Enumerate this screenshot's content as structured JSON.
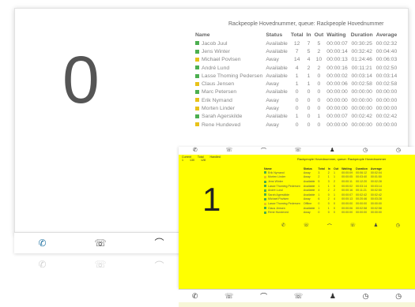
{
  "screen1": {
    "count": "0",
    "title": "Rackpeople Hovednummer, queue: Rackpeople Hovednummer",
    "columns": [
      "Name",
      "Status",
      "Total",
      "In",
      "Out",
      "Waiting",
      "Duration",
      "Average"
    ],
    "rows": [
      {
        "color": "#4caf50",
        "name": "Jacob Juul",
        "status": "Available",
        "total": "12",
        "in": "7",
        "out": "5",
        "waiting": "00:00:07",
        "duration": "00:30:25",
        "average": "00:02:32"
      },
      {
        "color": "#4caf50",
        "name": "Jens Winter",
        "status": "Available",
        "total": "7",
        "in": "5",
        "out": "2",
        "waiting": "00:00:14",
        "duration": "00:32:42",
        "average": "00:04:40"
      },
      {
        "color": "#e8c21a",
        "name": "Michael Povlsen",
        "status": "Away",
        "total": "14",
        "in": "4",
        "out": "10",
        "waiting": "00:00:13",
        "duration": "01:24:46",
        "average": "00:06:03"
      },
      {
        "color": "#4caf50",
        "name": "André Lund",
        "status": "Available",
        "total": "4",
        "in": "2",
        "out": "2",
        "waiting": "00:00:16",
        "duration": "00:11:21",
        "average": "00:02:50"
      },
      {
        "color": "#4caf50",
        "name": "Lasse Thoming Pedersen",
        "status": "Available",
        "total": "1",
        "in": "1",
        "out": "0",
        "waiting": "00:00:02",
        "duration": "00:03:14",
        "average": "00:03:14"
      },
      {
        "color": "#e8c21a",
        "name": "Claus Jensen",
        "status": "Away",
        "total": "1",
        "in": "1",
        "out": "0",
        "waiting": "00:00:06",
        "duration": "00:02:58",
        "average": "00:02:58"
      },
      {
        "color": "#4caf50",
        "name": "Marc Petersen",
        "status": "Available",
        "total": "0",
        "in": "0",
        "out": "0",
        "waiting": "00:00:00",
        "duration": "00:00:00",
        "average": "00:00:00"
      },
      {
        "color": "#e8c21a",
        "name": "Erik Nymand",
        "status": "Away",
        "total": "0",
        "in": "0",
        "out": "0",
        "waiting": "00:00:00",
        "duration": "00:00:00",
        "average": "00:00:00"
      },
      {
        "color": "#e8c21a",
        "name": "Morten Linder",
        "status": "Away",
        "total": "0",
        "in": "0",
        "out": "0",
        "waiting": "00:00:00",
        "duration": "00:00:00",
        "average": "00:00:00"
      },
      {
        "color": "#4caf50",
        "name": "Sarah Agerskilde",
        "status": "Available",
        "total": "1",
        "in": "0",
        "out": "1",
        "waiting": "00:00:07",
        "duration": "00:02:42",
        "average": "00:02:42"
      },
      {
        "color": "#e8c21a",
        "name": "Rene Hundeved",
        "status": "Away",
        "total": "0",
        "in": "0",
        "out": "0",
        "waiting": "00:00:00",
        "duration": "00:00:00",
        "average": "00:00:00"
      }
    ]
  },
  "screen2": {
    "count": "1",
    "title": "Rackpeople Hovednummer, queue: Rackpeople Hovednummer",
    "sub_labels": [
      "Current",
      "Total",
      "Handled"
    ],
    "sub_values": [
      "1",
      "130",
      "128"
    ],
    "columns": [
      "Name",
      "Status",
      "Total",
      "In",
      "Out",
      "Waiting",
      "Duration",
      "Average"
    ],
    "rows": [
      {
        "color": "#4caf50",
        "name": "Erik Nymand",
        "status": "Away",
        "total": "3",
        "in": "2",
        "out": "1",
        "waiting": "00:00:09",
        "duration": "00:06:12",
        "average": "00:02:04"
      },
      {
        "color": "#e8c21a",
        "name": "Morten Linder",
        "status": "Away",
        "total": "2",
        "in": "1",
        "out": "1",
        "waiting": "00:00:05",
        "duration": "00:03:40",
        "average": "00:01:50"
      },
      {
        "color": "#4caf50",
        "name": "Jens Winter",
        "status": "Available",
        "total": "5",
        "in": "3",
        "out": "2",
        "waiting": "00:00:11",
        "duration": "00:12:20",
        "average": "00:02:28"
      },
      {
        "color": "#4caf50",
        "name": "Lasse Thoming Pedersen",
        "status": "Available",
        "total": "1",
        "in": "1",
        "out": "0",
        "waiting": "00:00:02",
        "duration": "00:03:14",
        "average": "00:03:14"
      },
      {
        "color": "#4caf50",
        "name": "André Lund",
        "status": "Available",
        "total": "4",
        "in": "2",
        "out": "2",
        "waiting": "00:00:16",
        "duration": "00:11:21",
        "average": "00:02:50"
      },
      {
        "color": "#4caf50",
        "name": "Sarah Agerskilde",
        "status": "Available",
        "total": "1",
        "in": "0",
        "out": "1",
        "waiting": "00:00:07",
        "duration": "00:02:42",
        "average": "00:02:42"
      },
      {
        "color": "#4caf50",
        "name": "Michael Povlsen",
        "status": "Away",
        "total": "6",
        "in": "2",
        "out": "4",
        "waiting": "00:00:13",
        "duration": "00:20:46",
        "average": "00:03:28"
      },
      {
        "color": "#e8c21a",
        "name": "Lasse Thoming Pedersen",
        "status": "Offline",
        "total": "0",
        "in": "0",
        "out": "0",
        "waiting": "00:00:00",
        "duration": "00:00:00",
        "average": "00:00:00"
      },
      {
        "color": "#4caf50",
        "name": "Claus Jensen",
        "status": "Available",
        "total": "1",
        "in": "1",
        "out": "0",
        "waiting": "00:00:06",
        "duration": "00:02:58",
        "average": "00:02:58"
      },
      {
        "color": "#4caf50",
        "name": "Rene Hundeved",
        "status": "Away",
        "total": "0",
        "in": "0",
        "out": "0",
        "waiting": "00:00:00",
        "duration": "00:00:00",
        "average": "00:00:00"
      }
    ]
  },
  "toolbar_icons": [
    "phone-icon",
    "call-transfer-icon",
    "hang-up-icon",
    "call-forward-icon",
    "user-icon",
    "clock-icon",
    "clock-icon"
  ]
}
